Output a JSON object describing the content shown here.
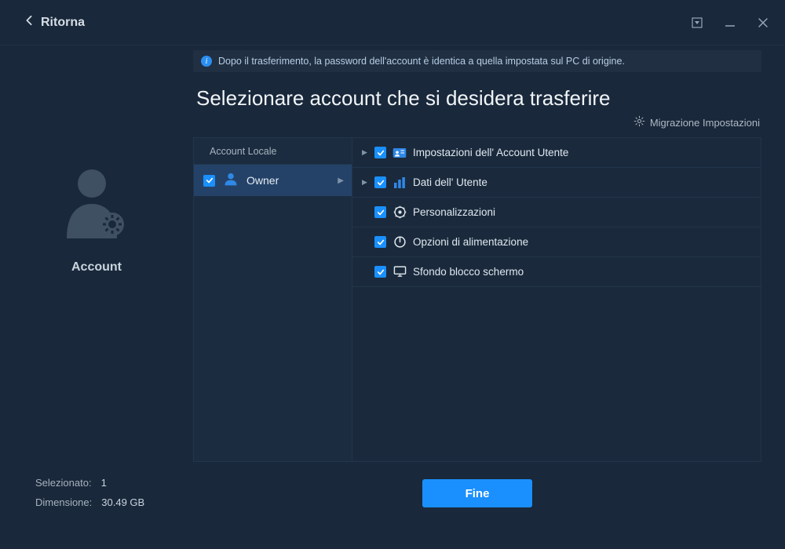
{
  "titlebar": {
    "back_label": "Ritorna"
  },
  "banner": {
    "text": "Dopo il trasferimento, la password dell'account è identica a quella impostata sul PC di origine."
  },
  "page_title": "Selezionare account che si desidera trasferire",
  "migration_link": "Migrazione Impostazioni",
  "sidebar": {
    "section_label": "Account",
    "stats": {
      "selected_label": "Selezionato:",
      "selected_value": "1",
      "size_label": "Dimensione:",
      "size_value": "30.49 GB"
    }
  },
  "accounts": {
    "header": "Account Locale",
    "items": [
      {
        "checked": true,
        "name": "Owner",
        "selected": true
      }
    ]
  },
  "settings": [
    {
      "expandable": true,
      "checked": true,
      "icon": "id-card",
      "label": "Impostazioni dell' Account Utente"
    },
    {
      "expandable": true,
      "checked": true,
      "icon": "bars",
      "label": "Dati dell' Utente"
    },
    {
      "expandable": false,
      "checked": true,
      "icon": "gear",
      "label": "Personalizzazioni"
    },
    {
      "expandable": false,
      "checked": true,
      "icon": "power",
      "label": "Opzioni di alimentazione"
    },
    {
      "expandable": false,
      "checked": true,
      "icon": "monitor",
      "label": "Sfondo blocco schermo"
    }
  ],
  "finish_label": "Fine"
}
